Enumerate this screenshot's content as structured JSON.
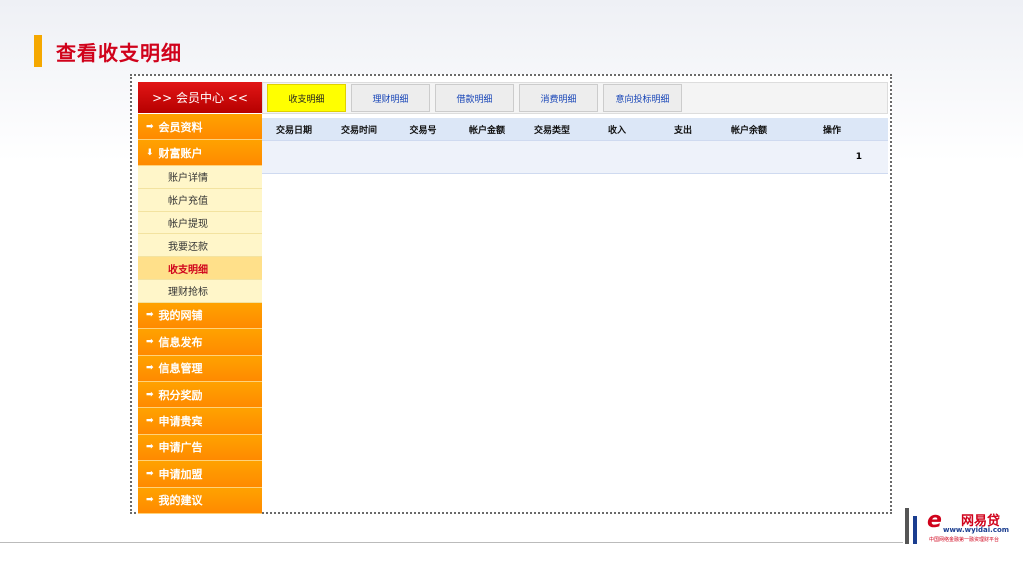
{
  "page": {
    "title": "查看收支明细"
  },
  "sidebar": {
    "header": ">> 会员中心 <<",
    "categories_top": [
      {
        "icon": "arrow-right-icon",
        "label": "会员资料"
      },
      {
        "icon": "arrow-down-icon",
        "label": "财富账户"
      }
    ],
    "sub_items": [
      {
        "label": "账户详情",
        "active": false
      },
      {
        "label": "帐户充值",
        "active": false
      },
      {
        "label": "帐户提现",
        "active": false
      },
      {
        "label": "我要还款",
        "active": false
      },
      {
        "label": "收支明细",
        "active": true
      },
      {
        "label": "理财抢标",
        "active": false
      }
    ],
    "categories_bottom": [
      {
        "label": "我的网铺"
      },
      {
        "label": "信息发布"
      },
      {
        "label": "信息管理"
      },
      {
        "label": "积分奖励"
      },
      {
        "label": "申请贵宾"
      },
      {
        "label": "申请广告"
      },
      {
        "label": "申请加盟"
      },
      {
        "label": "我的建议"
      }
    ]
  },
  "tabs": [
    {
      "label": "收支明细",
      "active": true
    },
    {
      "label": "理财明细",
      "active": false
    },
    {
      "label": "借款明细",
      "active": false
    },
    {
      "label": "消费明细",
      "active": false
    },
    {
      "label": "意向投标明细",
      "active": false
    }
  ],
  "table": {
    "columns": [
      "交易日期",
      "交易时间",
      "交易号",
      "帐户金额",
      "交易类型",
      "收入",
      "支出",
      "帐户余额",
      "操作"
    ],
    "pagination": "1"
  },
  "logo": {
    "name": "网易贷",
    "url": "www.wyidai.com",
    "tagline": "中国网络金融第一融资理财平台"
  },
  "colors": {
    "accent": "#d0021b",
    "orange": "#ff9500",
    "tab_active": "#ffff00"
  }
}
